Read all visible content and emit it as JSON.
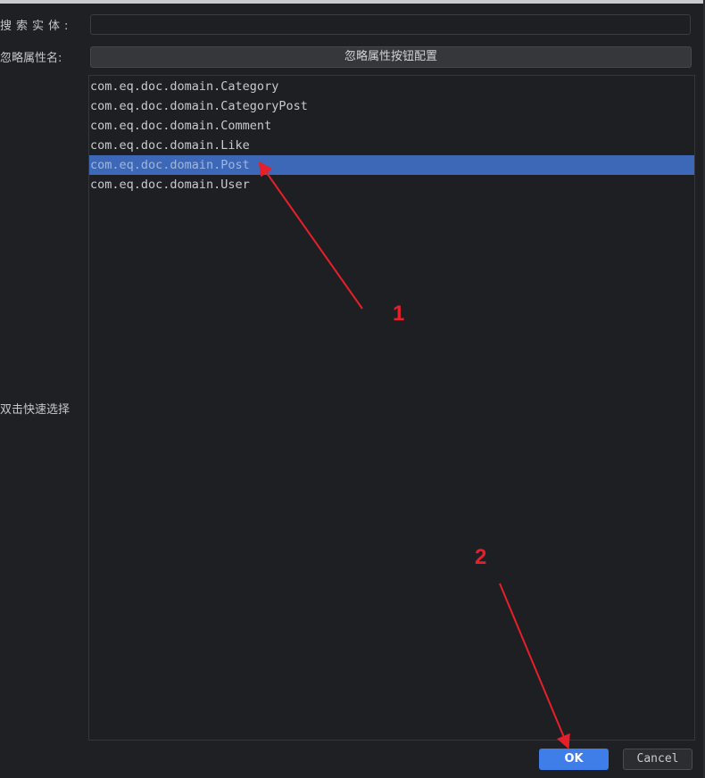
{
  "form": {
    "search_label": "搜索实体:",
    "search_value": "",
    "ignore_label": "忽略属性名:",
    "ignore_button": "忽略属性按钮配置",
    "quick_select_label": "双击快速选择"
  },
  "entity_list": {
    "items": [
      {
        "label": "com.eq.doc.domain.Category",
        "selected": false
      },
      {
        "label": "com.eq.doc.domain.CategoryPost",
        "selected": false
      },
      {
        "label": "com.eq.doc.domain.Comment",
        "selected": false
      },
      {
        "label": "com.eq.doc.domain.Like",
        "selected": false
      },
      {
        "label": "com.eq.doc.domain.Post",
        "selected": true
      },
      {
        "label": "com.eq.doc.domain.User",
        "selected": false
      }
    ]
  },
  "dialog_buttons": {
    "ok": "OK",
    "cancel": "Cancel"
  },
  "annotations": {
    "step1": "1",
    "step2": "2",
    "color": "#e6202a"
  },
  "colors": {
    "selection": "#3d68b8",
    "ok_button": "#3f7de8",
    "background": "#1f2023"
  }
}
